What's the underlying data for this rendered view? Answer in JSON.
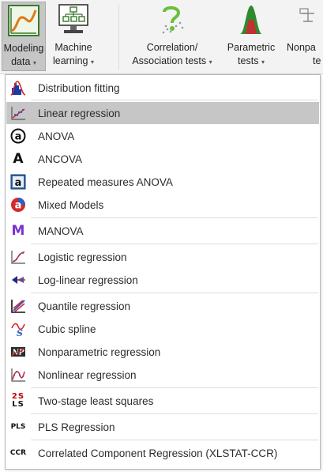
{
  "ribbon": {
    "modeling": {
      "line1": "Modeling",
      "line2": "data"
    },
    "ml": {
      "line1": "Machine",
      "line2": "learning"
    },
    "corr": {
      "line1": "Correlation/",
      "line2": "Association tests"
    },
    "param": {
      "line1": "Parametric",
      "line2": "tests"
    },
    "nonpar": {
      "line1": "Nonpa",
      "line2": "te"
    },
    "caret": "▾"
  },
  "menu": {
    "items": [
      {
        "label": "Distribution fitting",
        "icon": "distribution-fitting-icon"
      },
      {
        "label": "Linear regression",
        "icon": "linear-regression-icon"
      },
      {
        "label": "ANOVA",
        "icon": "anova-icon"
      },
      {
        "label": "ANCOVA",
        "icon": "ancova-icon"
      },
      {
        "label": "Repeated measures ANOVA",
        "icon": "repeated-measures-icon"
      },
      {
        "label": "Mixed Models",
        "icon": "mixed-models-icon"
      },
      {
        "label": "MANOVA",
        "icon": "manova-icon"
      },
      {
        "label": "Logistic regression",
        "icon": "logistic-regression-icon"
      },
      {
        "label": "Log-linear regression",
        "icon": "log-linear-icon"
      },
      {
        "label": "Quantile regression",
        "icon": "quantile-regression-icon"
      },
      {
        "label": "Cubic spline",
        "icon": "cubic-spline-icon"
      },
      {
        "label": "Nonparametric regression",
        "icon": "nonparametric-regression-icon"
      },
      {
        "label": "Nonlinear regression",
        "icon": "nonlinear-regression-icon"
      },
      {
        "label": "Two-stage least squares",
        "icon": "two-stage-least-squares-icon"
      },
      {
        "label": "PLS Regression",
        "icon": "pls-regression-icon"
      },
      {
        "label": "Correlated Component Regression (XLSTAT-CCR)",
        "icon": "ccr-icon"
      }
    ],
    "glyphs": {
      "anova": "a",
      "ancova": "A",
      "repeated": "a",
      "mixed": "a",
      "manova": "M",
      "two_stage_top": "2S",
      "two_stage_bottom": "LS",
      "pls": "PLS",
      "ccr": "CCR"
    }
  },
  "colors": {
    "highlight": "#c6c6c6",
    "manova_purple": "#7a2fd0",
    "mixed_red": "#d42a2a",
    "two_stage_red": "#c00000"
  }
}
